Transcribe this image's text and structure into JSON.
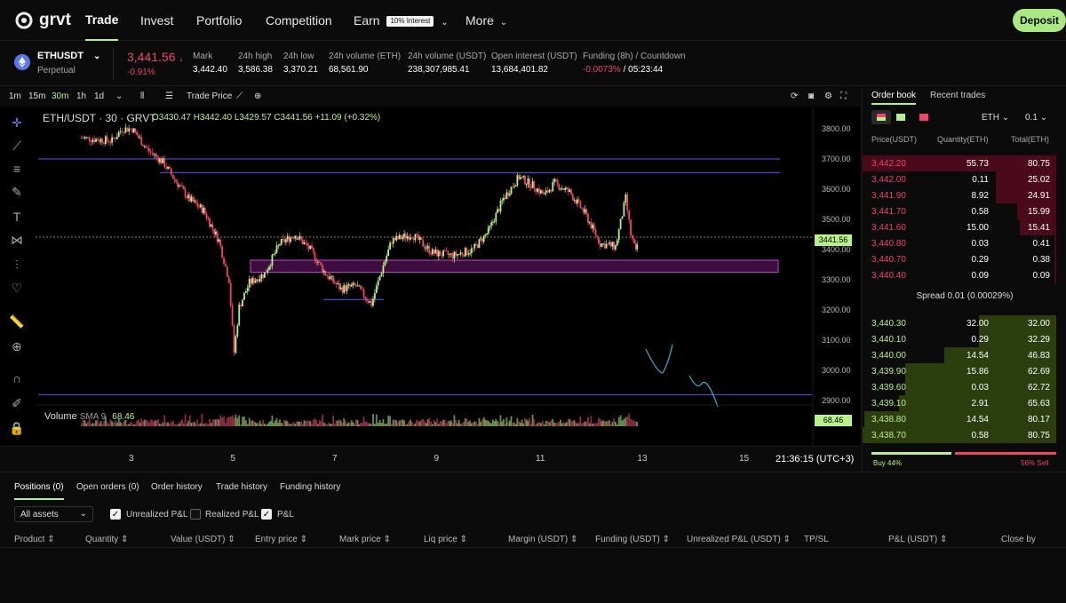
{
  "brand": "grvt",
  "nav": {
    "trade": "Trade",
    "invest": "Invest",
    "portfolio": "Portfolio",
    "competition": "Competition",
    "earn": "Earn",
    "earn_badge": "10% Interest",
    "more": "More",
    "deposit": "Deposit"
  },
  "ticker": {
    "symbol": "ETHUSDT",
    "type": "Perpetual",
    "price": "3,441.56",
    "price_change": "-0.91%",
    "stats": [
      {
        "label": "Mark",
        "value": "3,442.40"
      },
      {
        "label": "24h high",
        "value": "3,586.38"
      },
      {
        "label": "24h low",
        "value": "3,370.21"
      },
      {
        "label": "24h volume (ETH)",
        "value": "68,561.90"
      },
      {
        "label": "24h volume (USDT)",
        "value": "238,307,985.41"
      },
      {
        "label": "Open interest (USDT)",
        "value": "13,684,401.82"
      }
    ],
    "funding_label": "Funding (8h) / Countdown",
    "funding_rate": "-0.0073%",
    "countdown": "/ 05:23:44"
  },
  "toolbar": {
    "intervals": [
      "1m",
      "15m",
      "30m",
      "1h",
      "1d"
    ],
    "active_interval": "30m",
    "trade_price": "Trade Price"
  },
  "chart": {
    "legend_symbol": "ETH/USDT · 30 · GRVT",
    "ohlc": "O3430.47  H3442.40  L3429.57  C3441.56  +11.09 (+0.32%)",
    "volume_label": "Volume",
    "sma_label": "SMA 9",
    "sma_value": "68.46",
    "last_price_tag": "3441.56",
    "volume_tag": "68.46",
    "time": "21:36:15 (UTC+3)",
    "accent_up": "#b8f08c",
    "accent_down": "#f0446a"
  },
  "chart_data": {
    "type": "candlestick",
    "ylim": [
      2880,
      3850
    ],
    "y_ticks": [
      "3800.00",
      "3700.00",
      "3600.00",
      "3500.00",
      "3400.00",
      "3300.00",
      "3200.00",
      "3100.00",
      "3000.00",
      "2900.00"
    ],
    "x_ticks": [
      "3",
      "5",
      "7",
      "9",
      "11",
      "13",
      "15"
    ],
    "price_path": [
      [
        2.0,
        3770
      ],
      [
        2.6,
        3760
      ],
      [
        2.8,
        3800
      ],
      [
        3.0,
        3800
      ],
      [
        3.3,
        3730
      ],
      [
        3.6,
        3690
      ],
      [
        3.8,
        3640
      ],
      [
        4.1,
        3570
      ],
      [
        4.4,
        3530
      ],
      [
        4.7,
        3430
      ],
      [
        4.9,
        3300
      ],
      [
        5.0,
        3060
      ],
      [
        5.1,
        3210
      ],
      [
        5.3,
        3290
      ],
      [
        5.6,
        3320
      ],
      [
        5.9,
        3420
      ],
      [
        6.2,
        3450
      ],
      [
        6.5,
        3400
      ],
      [
        6.8,
        3320
      ],
      [
        7.1,
        3270
      ],
      [
        7.4,
        3280
      ],
      [
        7.7,
        3220
      ],
      [
        7.9,
        3330
      ],
      [
        8.1,
        3430
      ],
      [
        8.5,
        3450
      ],
      [
        8.9,
        3390
      ],
      [
        9.3,
        3380
      ],
      [
        9.7,
        3400
      ],
      [
        10.0,
        3460
      ],
      [
        10.3,
        3570
      ],
      [
        10.6,
        3640
      ],
      [
        10.9,
        3610
      ],
      [
        11.1,
        3580
      ],
      [
        11.3,
        3620
      ],
      [
        11.6,
        3590
      ],
      [
        11.9,
        3520
      ],
      [
        12.2,
        3420
      ],
      [
        12.5,
        3410
      ],
      [
        12.7,
        3570
      ],
      [
        12.8,
        3450
      ],
      [
        12.9,
        3390
      ],
      [
        12.95,
        3441.56
      ]
    ],
    "horizontal_lines": [
      3700,
      3655,
      3235,
      2920
    ],
    "zone": [
      3325,
      3365
    ]
  },
  "orderbook": {
    "tabs": [
      "Order book",
      "Recent trades"
    ],
    "asset": "ETH",
    "step": "0.1",
    "headers": [
      "Price(USDT)",
      "Quantity(ETH)",
      "Total(ETH)"
    ],
    "asks": [
      {
        "price": "3,442.20",
        "qty": "55.73",
        "total": "80.75"
      },
      {
        "price": "3,442.00",
        "qty": "0.11",
        "total": "25.02"
      },
      {
        "price": "3,441.90",
        "qty": "8.92",
        "total": "24.91"
      },
      {
        "price": "3,441.70",
        "qty": "0.58",
        "total": "15.99"
      },
      {
        "price": "3,441.60",
        "qty": "15.00",
        "total": "15.41"
      },
      {
        "price": "3,440.80",
        "qty": "0.03",
        "total": "0.41"
      },
      {
        "price": "3,440.70",
        "qty": "0.29",
        "total": "0.38"
      },
      {
        "price": "3,440.40",
        "qty": "0.09",
        "total": "0.09"
      }
    ],
    "spread": "Spread  0.01 (0.00029%)",
    "bids": [
      {
        "price": "3,440.30",
        "qty": "32.00",
        "total": "32.00"
      },
      {
        "price": "3,440.10",
        "qty": "0.29",
        "total": "32.29"
      },
      {
        "price": "3,440.00",
        "qty": "14.54",
        "total": "46.83"
      },
      {
        "price": "3,439.90",
        "qty": "15.86",
        "total": "62.69"
      },
      {
        "price": "3,439.60",
        "qty": "0.03",
        "total": "62.72"
      },
      {
        "price": "3,439.10",
        "qty": "2.91",
        "total": "65.63"
      },
      {
        "price": "3,438.80",
        "qty": "14.54",
        "total": "80.17"
      },
      {
        "price": "3,438.70",
        "qty": "0.58",
        "total": "80.75"
      }
    ],
    "ask_depth": [
      1.0,
      0.31,
      0.31,
      0.2,
      0.19,
      0.01,
      0.005,
      0.001
    ],
    "bid_depth": [
      0.4,
      0.4,
      0.58,
      0.78,
      0.78,
      0.81,
      0.99,
      1.0
    ],
    "buy_pct": "Buy 44%",
    "sell_pct": "56% Sell",
    "buy_ratio": 0.44
  },
  "bottom": {
    "tabs": [
      "Positions (0)",
      "Open orders (0)",
      "Order history",
      "Trade history",
      "Funding history"
    ],
    "filter": "All assets",
    "checks": [
      {
        "label": "Unrealized P&L",
        "on": true
      },
      {
        "label": "Realized P&L",
        "on": false
      },
      {
        "label": "P&L",
        "on": true
      }
    ],
    "columns": [
      "Product",
      "Quantity",
      "Value (USDT)",
      "Entry price",
      "Mark price",
      "Liq price",
      "Margin (USDT)",
      "Funding (USDT)",
      "Unrealized P&L (USDT)",
      "TP/SL",
      "P&L (USDT)",
      "Close by"
    ]
  }
}
